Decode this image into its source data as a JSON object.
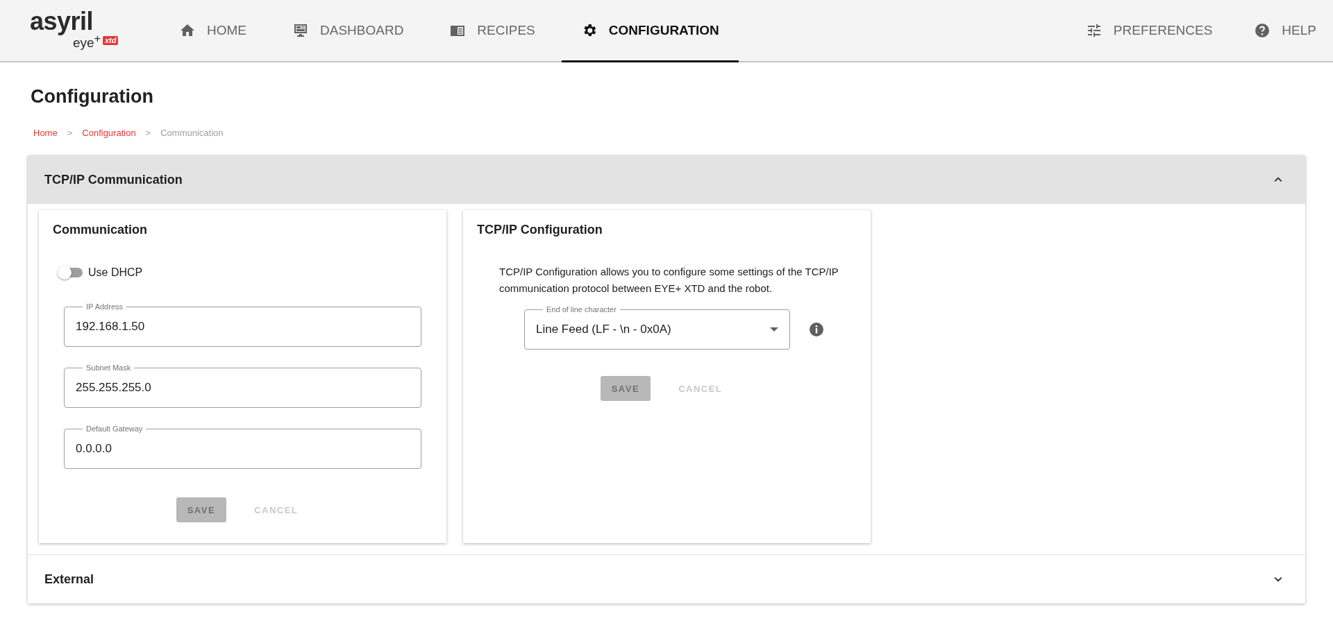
{
  "logo": {
    "brand": "asyril",
    "product": "eye$^{+}$",
    "badge": "xtd"
  },
  "nav": [
    {
      "label": "HOME",
      "selected": false
    },
    {
      "label": "DASHBOARD",
      "selected": false
    },
    {
      "label": "RECIPES",
      "selected": false
    },
    {
      "label": "CONFIGURATION",
      "selected": true
    }
  ],
  "nav_right": [
    {
      "label": "PREFERENCES"
    },
    {
      "label": "HELP"
    }
  ],
  "page_title": "Configuration",
  "breadcrumb": [
    {
      "label": "Home",
      "kind": "link"
    },
    {
      "label": "Configuration",
      "kind": "link",
      "separator": ">"
    },
    {
      "label": "Communication",
      "kind": "current",
      "separator": ">"
    }
  ],
  "sections": [
    {
      "title": "TCP/IP Communication",
      "expanded": true
    },
    {
      "title": "External",
      "expanded": false
    }
  ],
  "communication_card": {
    "title": "Communication",
    "toggle": {
      "label": "Use DHCP",
      "on": false
    },
    "fields": [
      {
        "label": "IP Address",
        "value": "192.168.1.50"
      },
      {
        "label": "Subnet Mask",
        "value": "255.255.255.0"
      },
      {
        "label": "Default Gateway",
        "value": "0.0.0.0"
      }
    ],
    "buttons": [
      {
        "label": "SAVE",
        "kind": "primary",
        "disabled": true
      },
      {
        "label": "CANCEL",
        "kind": "text",
        "disabled": true
      }
    ]
  },
  "tcp_card": {
    "title": "TCP/IP Configuration",
    "description": "TCP/IP Configuration allows you to configure some settings of the TCP/IP communication protocol between EYE+ XTD and the robot.",
    "select": {
      "label": "End of line character",
      "value": "Line Feed (LF - \\n - 0x0A)"
    },
    "buttons": [
      {
        "label": "SAVE",
        "kind": "primary",
        "disabled": true
      },
      {
        "label": "CANCEL",
        "kind": "text",
        "disabled": true
      }
    ]
  }
}
